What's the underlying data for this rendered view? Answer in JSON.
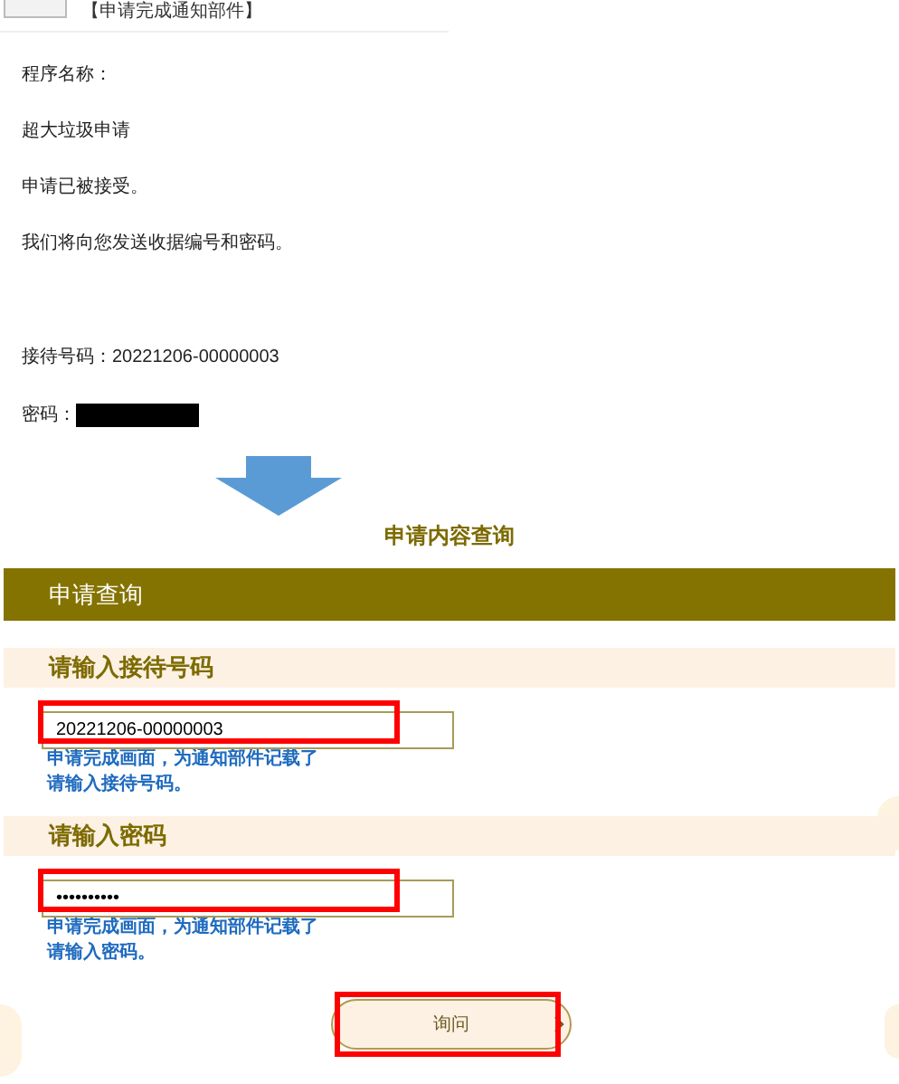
{
  "mail": {
    "subject": "【申请完成通知部件】",
    "lines": [
      {
        "text": "程序名称："
      },
      {
        "text": "超大垃圾申请"
      },
      {
        "text": "申请已被接受。"
      },
      {
        "text": "我们将向您发送收据编号和密码。"
      }
    ],
    "reception_number": "接待号码：20221206-00000003",
    "password_label": "密码：",
    "password_redacted": true
  },
  "page_title": "申请内容查询",
  "panel_title": "申请查询",
  "fields": [
    {
      "label": "请输入接待号码",
      "value": "20221206-00000003",
      "highlighted": true,
      "hint": [
        "申请完成画面，为通知部件记载了",
        "请输入接待号码。"
      ]
    },
    {
      "label": "请输入密码",
      "value": "••••••••••",
      "highlighted": true,
      "hint": [
        "申请完成画面，为通知部件记载了",
        "请输入密码。"
      ]
    }
  ],
  "submit": {
    "label": "询问",
    "highlighted": true
  }
}
